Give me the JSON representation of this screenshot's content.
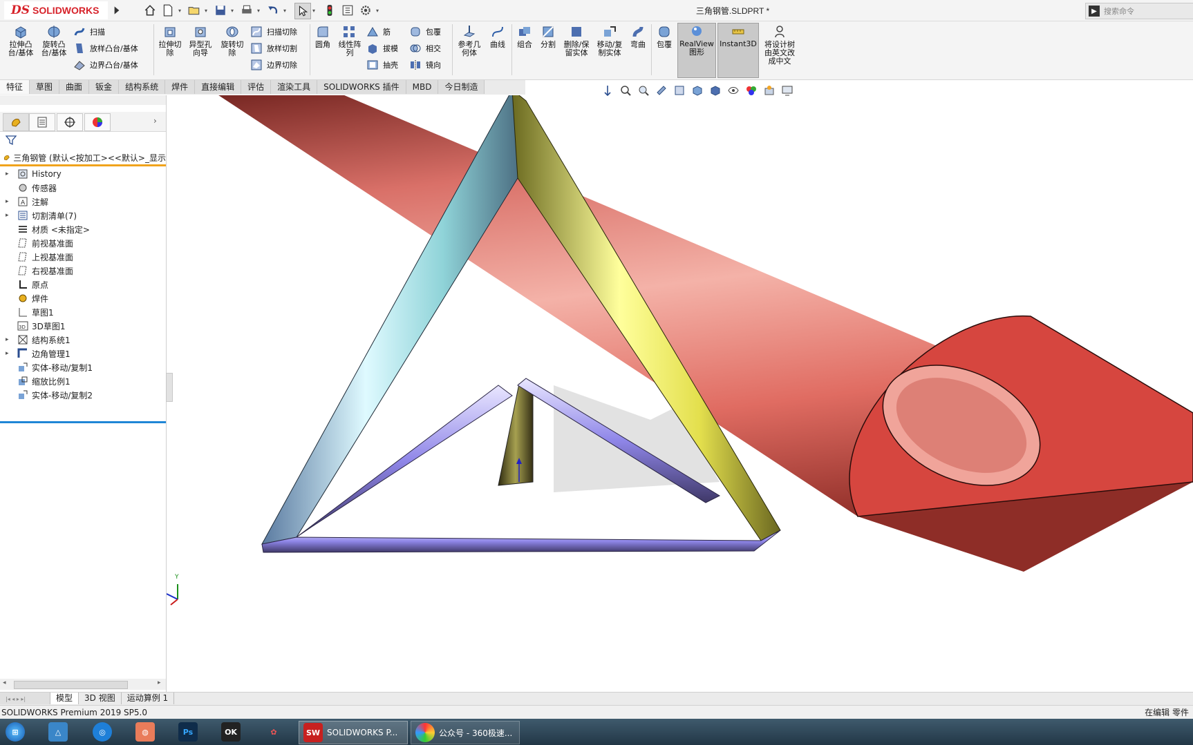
{
  "app": {
    "logo_text": "SOLIDWORKS",
    "document_title": "三角钢管.SLDPRT *",
    "search_placeholder": "搜索命令"
  },
  "ribbon": {
    "groups": [
      {
        "label": "拉伸凸\n台/基体",
        "icon": "extruded-boss-icon"
      },
      {
        "label": "旋转凸\n台/基体",
        "icon": "revolved-boss-icon"
      },
      {
        "label": "扫描",
        "icon": "swept-boss-icon"
      },
      {
        "label": "放样凸台/基体",
        "icon": "lofted-boss-icon"
      },
      {
        "label": "边界凸台/基体",
        "icon": "boundary-boss-icon"
      },
      {
        "label": "拉伸切\n除",
        "icon": "extruded-cut-icon"
      },
      {
        "label": "异型孔\n向导",
        "icon": "hole-wizard-icon"
      },
      {
        "label": "旋转切\n除",
        "icon": "revolved-cut-icon"
      },
      {
        "label": "扫描切除",
        "icon": "swept-cut-icon"
      },
      {
        "label": "放样切割",
        "icon": "lofted-cut-icon"
      },
      {
        "label": "边界切除",
        "icon": "boundary-cut-icon"
      },
      {
        "label": "圆角",
        "icon": "fillet-icon"
      },
      {
        "label": "线性阵\n列",
        "icon": "linear-pattern-icon"
      },
      {
        "label": "筋",
        "icon": "rib-icon"
      },
      {
        "label": "拔模",
        "icon": "draft-icon"
      },
      {
        "label": "抽壳",
        "icon": "shell-icon"
      },
      {
        "label": "包覆",
        "icon": "wrap-icon"
      },
      {
        "label": "相交",
        "icon": "intersect-icon"
      },
      {
        "label": "镜向",
        "icon": "mirror-icon"
      },
      {
        "label": "参考几\n何体",
        "icon": "reference-geometry-icon"
      },
      {
        "label": "曲线",
        "icon": "curves-icon"
      },
      {
        "label": "组合",
        "icon": "combine-icon"
      },
      {
        "label": "分割",
        "icon": "split-icon"
      },
      {
        "label": "删除/保\n留实体",
        "icon": "delete-body-icon"
      },
      {
        "label": "移动/复\n制实体",
        "icon": "move-copy-body-icon"
      },
      {
        "label": "弯曲",
        "icon": "flex-icon"
      },
      {
        "label": "包覆",
        "icon": "wrap2-icon"
      },
      {
        "label": "RealView\n图形",
        "icon": "realview-icon"
      },
      {
        "label": "Instant3D",
        "icon": "instant3d-icon"
      },
      {
        "label": "将设计树\n由英文改\n成中文",
        "icon": "translate-tree-icon"
      }
    ]
  },
  "command_tabs": [
    "特征",
    "草图",
    "曲面",
    "钣金",
    "结构系统",
    "焊件",
    "直接编辑",
    "评估",
    "渲染工具",
    "SOLIDWORKS 插件",
    "MBD",
    "今日制造"
  ],
  "tree": {
    "root": "三角钢管 (默认<按加工><<默认>_显示",
    "items": [
      {
        "label": "History",
        "expandable": true,
        "icon": "history-icon"
      },
      {
        "label": "传感器",
        "expandable": false,
        "icon": "sensor-icon"
      },
      {
        "label": "注解",
        "expandable": true,
        "icon": "annotation-icon"
      },
      {
        "label": "切割清单(7)",
        "expandable": true,
        "icon": "cut-list-icon"
      },
      {
        "label": "材质 <未指定>",
        "expandable": false,
        "icon": "material-icon"
      },
      {
        "label": "前视基准面",
        "expandable": false,
        "icon": "plane-icon"
      },
      {
        "label": "上视基准面",
        "expandable": false,
        "icon": "plane-icon"
      },
      {
        "label": "右视基准面",
        "expandable": false,
        "icon": "plane-icon"
      },
      {
        "label": "原点",
        "expandable": false,
        "icon": "origin-icon"
      },
      {
        "label": "焊件",
        "expandable": false,
        "icon": "weldment-icon"
      },
      {
        "label": "草图1",
        "expandable": false,
        "icon": "sketch-icon"
      },
      {
        "label": "3D草图1",
        "expandable": false,
        "icon": "3d-sketch-icon"
      },
      {
        "label": "结构系统1",
        "expandable": true,
        "icon": "structure-system-icon"
      },
      {
        "label": "边角管理1",
        "expandable": true,
        "icon": "corner-management-icon"
      },
      {
        "label": "实体-移动/复制1",
        "expandable": false,
        "icon": "move-copy-icon"
      },
      {
        "label": "缩放比例1",
        "expandable": false,
        "icon": "scale-icon"
      },
      {
        "label": "实体-移动/复制2",
        "expandable": false,
        "icon": "move-copy-icon"
      }
    ]
  },
  "bottom_tabs": [
    "模型",
    "3D 视图",
    "运动算例 1"
  ],
  "status": {
    "left": "SOLIDWORKS Premium 2019 SP5.0",
    "right": "在编辑 零件"
  },
  "taskbar": {
    "apps": [
      {
        "label": "",
        "icon": "windows-start-icon"
      },
      {
        "label": "",
        "icon": "app-triangle-icon"
      },
      {
        "label": "",
        "icon": "app-circle-icon"
      },
      {
        "label": "",
        "icon": "app-browser-icon"
      },
      {
        "label": "Ps",
        "icon": "photoshop-icon"
      },
      {
        "label": "",
        "icon": "app-ok-icon"
      },
      {
        "label": "",
        "icon": "app-stamp-icon"
      },
      {
        "label": "SOLIDWORKS P...",
        "icon": "solidworks-icon"
      },
      {
        "label": "公众号 - 360极速...",
        "icon": "360-browser-icon"
      }
    ]
  },
  "colors": {
    "accent_tree": "#f0a31c",
    "selection_line": "#1f86d6",
    "brand": "#d7222a",
    "pipe": "#e05a55"
  }
}
